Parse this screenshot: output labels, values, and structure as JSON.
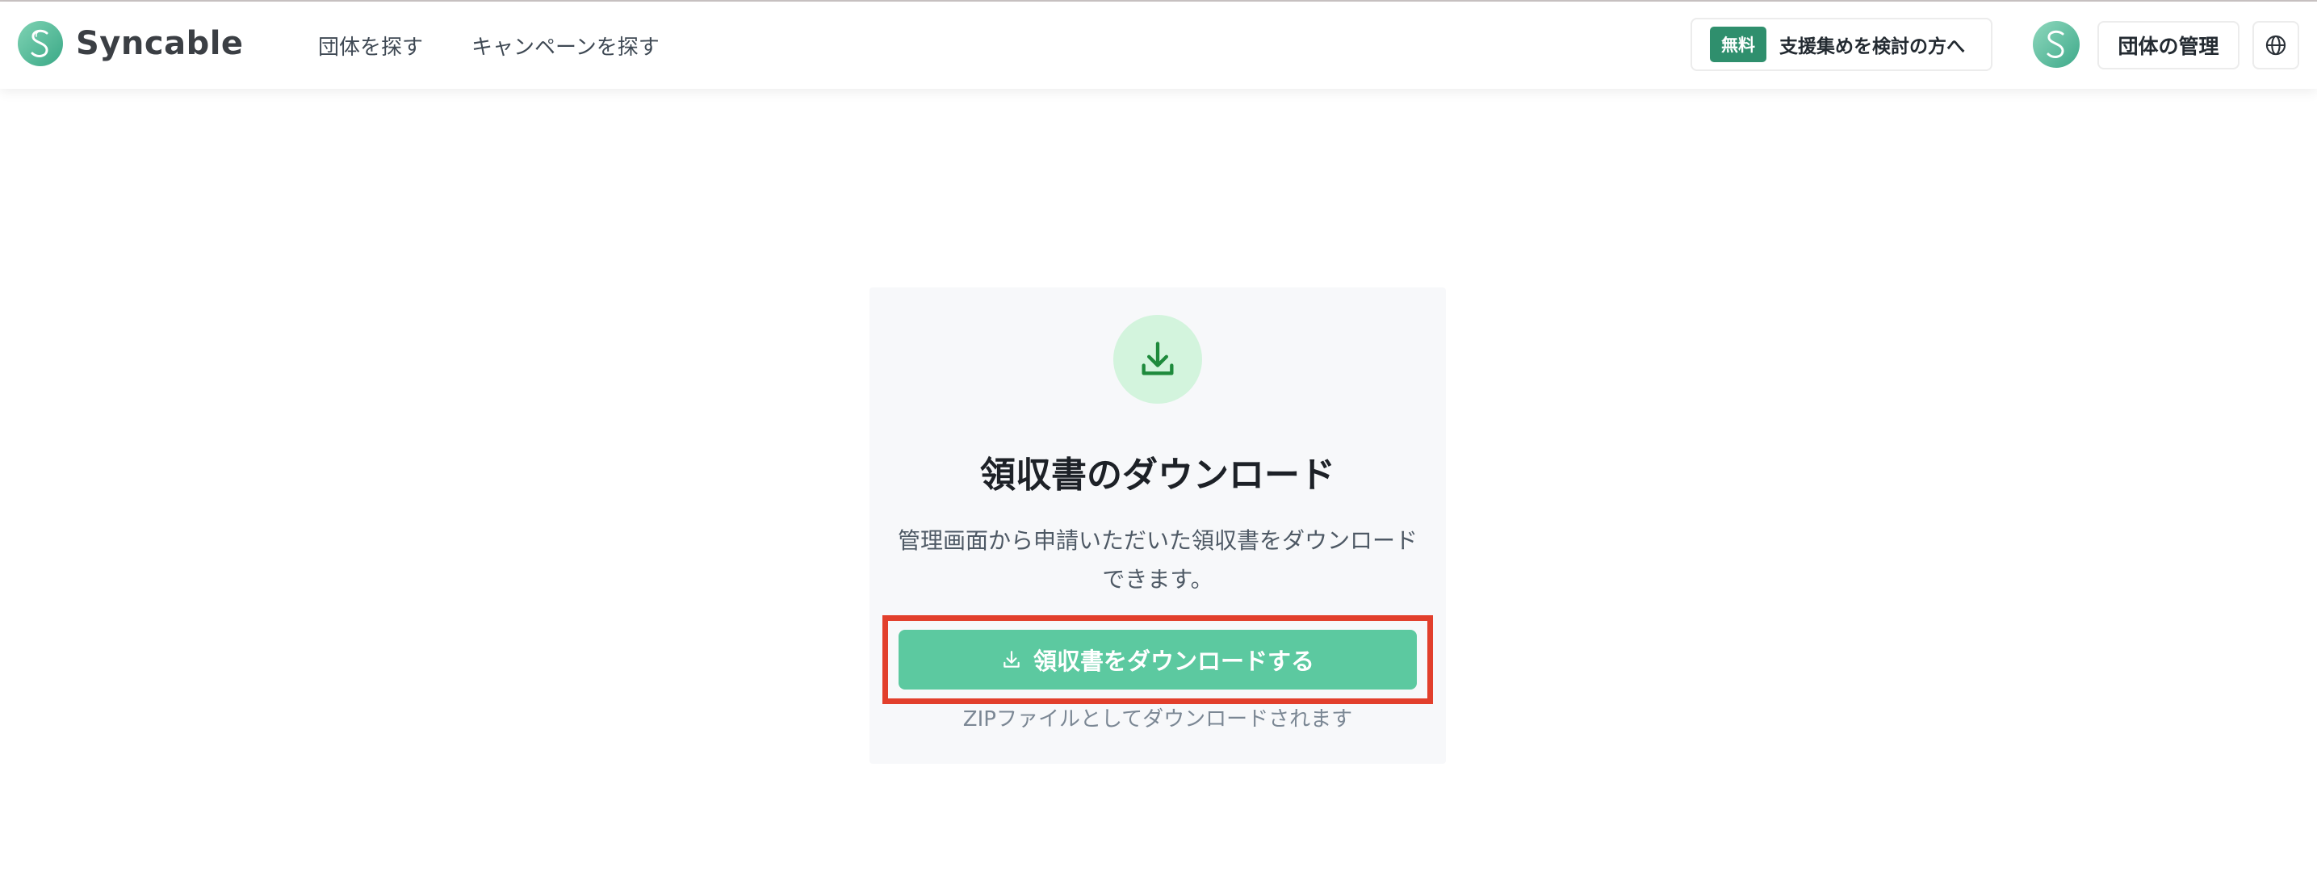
{
  "header": {
    "logo_text": "Syncable",
    "nav": [
      {
        "label": "団体を探す"
      },
      {
        "label": "キャンペーンを探す"
      }
    ],
    "cta": {
      "badge": "無料",
      "label": "支援集めを検討の方へ"
    },
    "manage_label": "団体の管理",
    "icons": {
      "logo": "syncable-logo-icon",
      "avatar": "user-avatar",
      "language": "globe-icon"
    }
  },
  "card": {
    "icon": "download-icon",
    "title": "領収書のダウンロード",
    "description": "管理画面から申請いただいた領収書をダウンロードできます。",
    "button_label": "領収書をダウンロードする",
    "note": "ZIPファイルとしてダウンロードされます"
  },
  "colors": {
    "brand": "#5cc9a0",
    "badge": "#2f8f6d",
    "icon_bg": "#d3f4dd",
    "icon_fg": "#1e8a3c",
    "highlight": "#e23f2c"
  }
}
